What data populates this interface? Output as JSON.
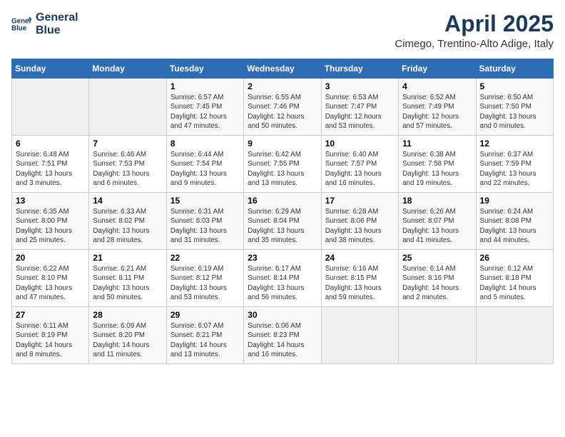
{
  "header": {
    "logo_line1": "General",
    "logo_line2": "Blue",
    "title": "April 2025",
    "subtitle": "Cimego, Trentino-Alto Adige, Italy"
  },
  "days_of_week": [
    "Sunday",
    "Monday",
    "Tuesday",
    "Wednesday",
    "Thursday",
    "Friday",
    "Saturday"
  ],
  "weeks": [
    [
      null,
      null,
      {
        "day": "1",
        "sunrise": "Sunrise: 6:57 AM",
        "sunset": "Sunset: 7:45 PM",
        "daylight": "Daylight: 12 hours and 47 minutes."
      },
      {
        "day": "2",
        "sunrise": "Sunrise: 6:55 AM",
        "sunset": "Sunset: 7:46 PM",
        "daylight": "Daylight: 12 hours and 50 minutes."
      },
      {
        "day": "3",
        "sunrise": "Sunrise: 6:53 AM",
        "sunset": "Sunset: 7:47 PM",
        "daylight": "Daylight: 12 hours and 53 minutes."
      },
      {
        "day": "4",
        "sunrise": "Sunrise: 6:52 AM",
        "sunset": "Sunset: 7:49 PM",
        "daylight": "Daylight: 12 hours and 57 minutes."
      },
      {
        "day": "5",
        "sunrise": "Sunrise: 6:50 AM",
        "sunset": "Sunset: 7:50 PM",
        "daylight": "Daylight: 13 hours and 0 minutes."
      }
    ],
    [
      {
        "day": "6",
        "sunrise": "Sunrise: 6:48 AM",
        "sunset": "Sunset: 7:51 PM",
        "daylight": "Daylight: 13 hours and 3 minutes."
      },
      {
        "day": "7",
        "sunrise": "Sunrise: 6:46 AM",
        "sunset": "Sunset: 7:53 PM",
        "daylight": "Daylight: 13 hours and 6 minutes."
      },
      {
        "day": "8",
        "sunrise": "Sunrise: 6:44 AM",
        "sunset": "Sunset: 7:54 PM",
        "daylight": "Daylight: 13 hours and 9 minutes."
      },
      {
        "day": "9",
        "sunrise": "Sunrise: 6:42 AM",
        "sunset": "Sunset: 7:55 PM",
        "daylight": "Daylight: 13 hours and 13 minutes."
      },
      {
        "day": "10",
        "sunrise": "Sunrise: 6:40 AM",
        "sunset": "Sunset: 7:57 PM",
        "daylight": "Daylight: 13 hours and 16 minutes."
      },
      {
        "day": "11",
        "sunrise": "Sunrise: 6:38 AM",
        "sunset": "Sunset: 7:58 PM",
        "daylight": "Daylight: 13 hours and 19 minutes."
      },
      {
        "day": "12",
        "sunrise": "Sunrise: 6:37 AM",
        "sunset": "Sunset: 7:59 PM",
        "daylight": "Daylight: 13 hours and 22 minutes."
      }
    ],
    [
      {
        "day": "13",
        "sunrise": "Sunrise: 6:35 AM",
        "sunset": "Sunset: 8:00 PM",
        "daylight": "Daylight: 13 hours and 25 minutes."
      },
      {
        "day": "14",
        "sunrise": "Sunrise: 6:33 AM",
        "sunset": "Sunset: 8:02 PM",
        "daylight": "Daylight: 13 hours and 28 minutes."
      },
      {
        "day": "15",
        "sunrise": "Sunrise: 6:31 AM",
        "sunset": "Sunset: 8:03 PM",
        "daylight": "Daylight: 13 hours and 31 minutes."
      },
      {
        "day": "16",
        "sunrise": "Sunrise: 6:29 AM",
        "sunset": "Sunset: 8:04 PM",
        "daylight": "Daylight: 13 hours and 35 minutes."
      },
      {
        "day": "17",
        "sunrise": "Sunrise: 6:28 AM",
        "sunset": "Sunset: 8:06 PM",
        "daylight": "Daylight: 13 hours and 38 minutes."
      },
      {
        "day": "18",
        "sunrise": "Sunrise: 6:26 AM",
        "sunset": "Sunset: 8:07 PM",
        "daylight": "Daylight: 13 hours and 41 minutes."
      },
      {
        "day": "19",
        "sunrise": "Sunrise: 6:24 AM",
        "sunset": "Sunset: 8:08 PM",
        "daylight": "Daylight: 13 hours and 44 minutes."
      }
    ],
    [
      {
        "day": "20",
        "sunrise": "Sunrise: 6:22 AM",
        "sunset": "Sunset: 8:10 PM",
        "daylight": "Daylight: 13 hours and 47 minutes."
      },
      {
        "day": "21",
        "sunrise": "Sunrise: 6:21 AM",
        "sunset": "Sunset: 8:11 PM",
        "daylight": "Daylight: 13 hours and 50 minutes."
      },
      {
        "day": "22",
        "sunrise": "Sunrise: 6:19 AM",
        "sunset": "Sunset: 8:12 PM",
        "daylight": "Daylight: 13 hours and 53 minutes."
      },
      {
        "day": "23",
        "sunrise": "Sunrise: 6:17 AM",
        "sunset": "Sunset: 8:14 PM",
        "daylight": "Daylight: 13 hours and 56 minutes."
      },
      {
        "day": "24",
        "sunrise": "Sunrise: 6:16 AM",
        "sunset": "Sunset: 8:15 PM",
        "daylight": "Daylight: 13 hours and 59 minutes."
      },
      {
        "day": "25",
        "sunrise": "Sunrise: 6:14 AM",
        "sunset": "Sunset: 8:16 PM",
        "daylight": "Daylight: 14 hours and 2 minutes."
      },
      {
        "day": "26",
        "sunrise": "Sunrise: 6:12 AM",
        "sunset": "Sunset: 8:18 PM",
        "daylight": "Daylight: 14 hours and 5 minutes."
      }
    ],
    [
      {
        "day": "27",
        "sunrise": "Sunrise: 6:11 AM",
        "sunset": "Sunset: 8:19 PM",
        "daylight": "Daylight: 14 hours and 8 minutes."
      },
      {
        "day": "28",
        "sunrise": "Sunrise: 6:09 AM",
        "sunset": "Sunset: 8:20 PM",
        "daylight": "Daylight: 14 hours and 11 minutes."
      },
      {
        "day": "29",
        "sunrise": "Sunrise: 6:07 AM",
        "sunset": "Sunset: 8:21 PM",
        "daylight": "Daylight: 14 hours and 13 minutes."
      },
      {
        "day": "30",
        "sunrise": "Sunrise: 6:06 AM",
        "sunset": "Sunset: 8:23 PM",
        "daylight": "Daylight: 14 hours and 16 minutes."
      },
      null,
      null,
      null
    ]
  ]
}
